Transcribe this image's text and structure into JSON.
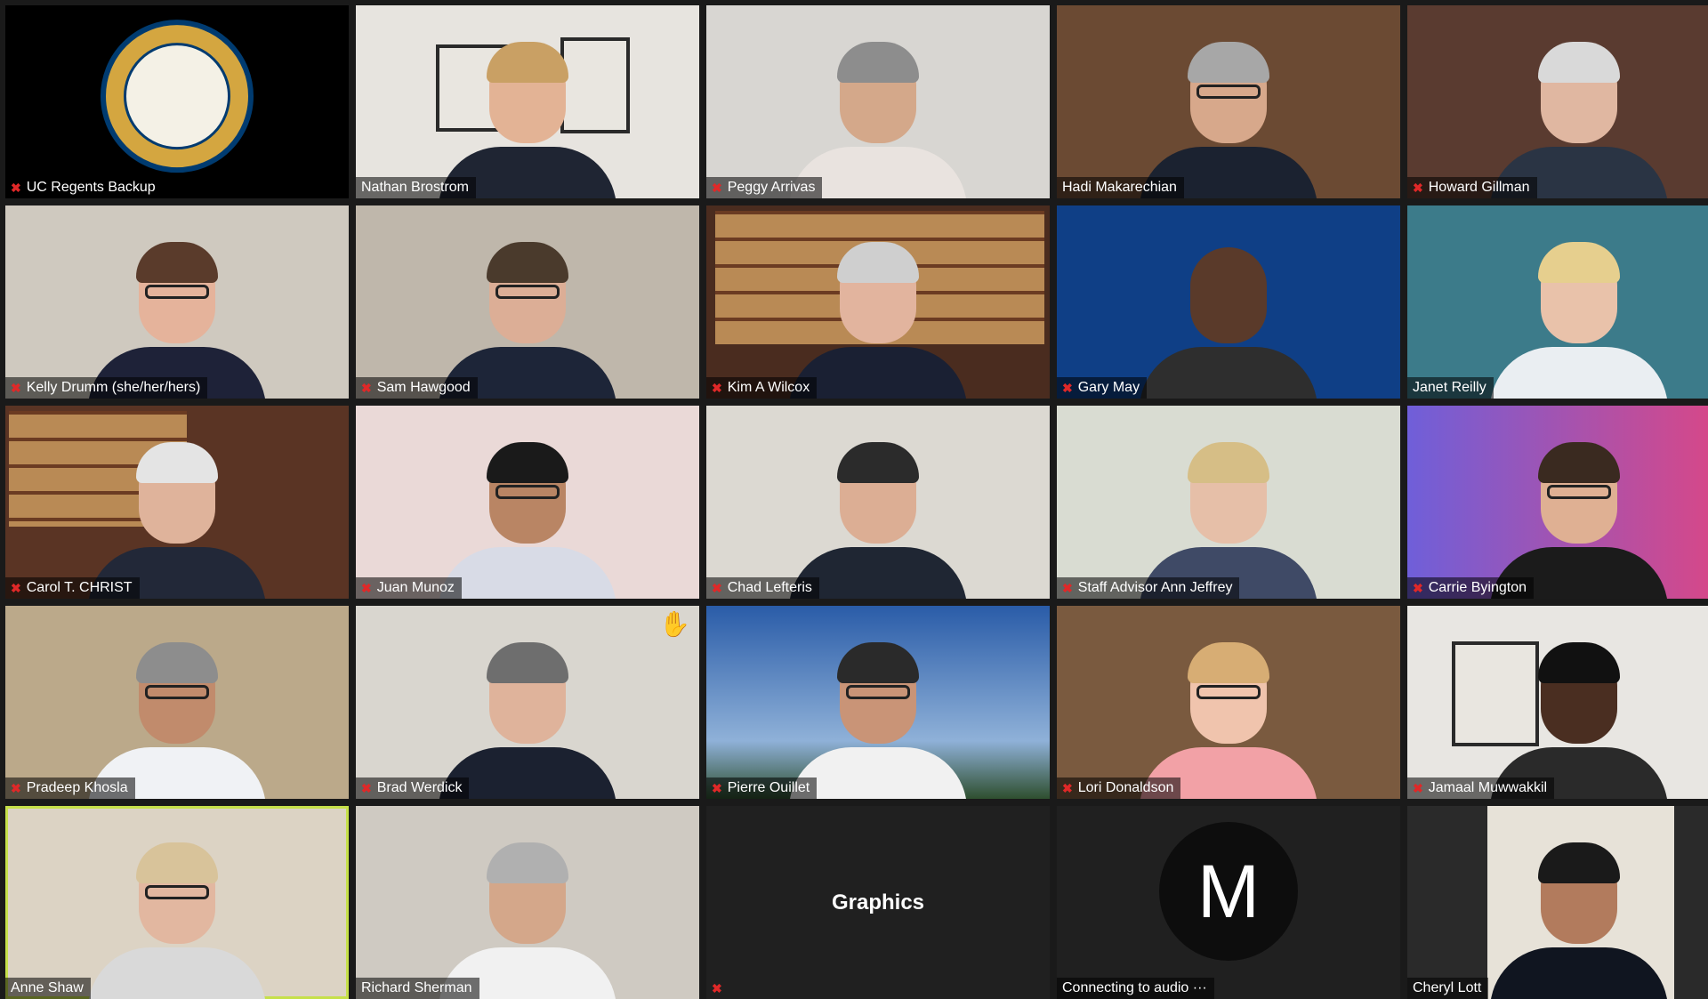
{
  "participants": [
    {
      "name": "UC Regents Backup",
      "muted": true
    },
    {
      "name": "Nathan Brostrom",
      "muted": false
    },
    {
      "name": "Peggy Arrivas",
      "muted": true
    },
    {
      "name": "Hadi Makarechian",
      "muted": false
    },
    {
      "name": "Howard Gillman",
      "muted": true
    },
    {
      "name": "Kelly Drumm (she/her/hers)",
      "muted": true
    },
    {
      "name": "Sam Hawgood",
      "muted": true
    },
    {
      "name": "Kim A Wilcox",
      "muted": true
    },
    {
      "name": "Gary May",
      "muted": true
    },
    {
      "name": "Janet Reilly",
      "muted": false
    },
    {
      "name": "Carol T. CHRIST",
      "muted": true
    },
    {
      "name": "Juan Munoz",
      "muted": true
    },
    {
      "name": "Chad Lefteris",
      "muted": true
    },
    {
      "name": "Staff Advisor Ann Jeffrey",
      "muted": true
    },
    {
      "name": "Carrie Byington",
      "muted": true
    },
    {
      "name": "Pradeep Khosla",
      "muted": true
    },
    {
      "name": "Brad Werdick",
      "muted": true
    },
    {
      "name": "Pierre Ouillet",
      "muted": true
    },
    {
      "name": "Lori Donaldson",
      "muted": true
    },
    {
      "name": "Jamaal Muwwakkil",
      "muted": true
    },
    {
      "name": "Anne Shaw",
      "muted": false
    },
    {
      "name": "Richard Sherman",
      "muted": false
    },
    {
      "name": "Graphics",
      "muted": true
    },
    {
      "name": "Connecting to audio ···",
      "muted": false
    },
    {
      "name": "Cheryl Lott",
      "muted": false
    }
  ],
  "graphics_tile_label": "Graphics",
  "avatar_letter": "M",
  "icons": {
    "mic_muted": "mic-muted-icon",
    "raised_hand": "raised-hand-icon"
  },
  "colors": {
    "active_speaker_border": "#c6e04a",
    "muted_icon": "#e02828"
  }
}
